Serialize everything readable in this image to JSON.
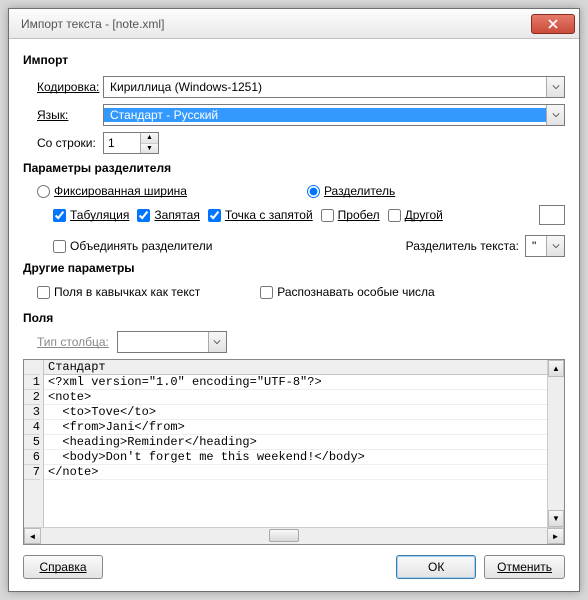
{
  "window": {
    "title": "Импорт текста - [note.xml]"
  },
  "import": {
    "group_title": "Импорт",
    "encoding_label": "Кодировка:",
    "encoding_value": "Кириллица (Windows-1251)",
    "language_label": "Язык:",
    "language_value": "Стандарт - Русский",
    "from_row_label": "Со строки:",
    "from_row_value": "1"
  },
  "separator": {
    "group_title": "Параметры разделителя",
    "fixed_width_label": "Фиксированная ширина",
    "fixed_width_checked": false,
    "separator_label": "Разделитель",
    "separator_checked": true,
    "tab_label": "Табуляция",
    "tab_checked": true,
    "comma_label": "Запятая",
    "comma_checked": true,
    "semicolon_label": "Точка с запятой",
    "semicolon_checked": true,
    "space_label": "Пробел",
    "space_checked": false,
    "other_label": "Другой",
    "other_checked": false,
    "other_value": "",
    "merge_label": "Объединять разделители",
    "merge_checked": false,
    "text_sep_label": "Разделитель текста:",
    "text_sep_value": "\""
  },
  "other": {
    "group_title": "Другие параметры",
    "quoted_as_text_label": "Поля в кавычках как текст",
    "quoted_as_text_checked": false,
    "detect_numbers_label": "Распознавать особые числа",
    "detect_numbers_checked": false
  },
  "fields": {
    "group_title": "Поля",
    "column_type_label": "Тип столбца:",
    "column_type_value": "",
    "header": "Стандарт",
    "rows": [
      "<?xml version=\"1.0\" encoding=\"UTF-8\"?>",
      "<note>",
      "  <to>Tove</to>",
      "  <from>Jani</from>",
      "  <heading>Reminder</heading>",
      "  <body>Don't forget me this weekend!</body>",
      "</note>"
    ]
  },
  "buttons": {
    "help": "Справка",
    "ok": "ОК",
    "cancel": "Отменить"
  }
}
